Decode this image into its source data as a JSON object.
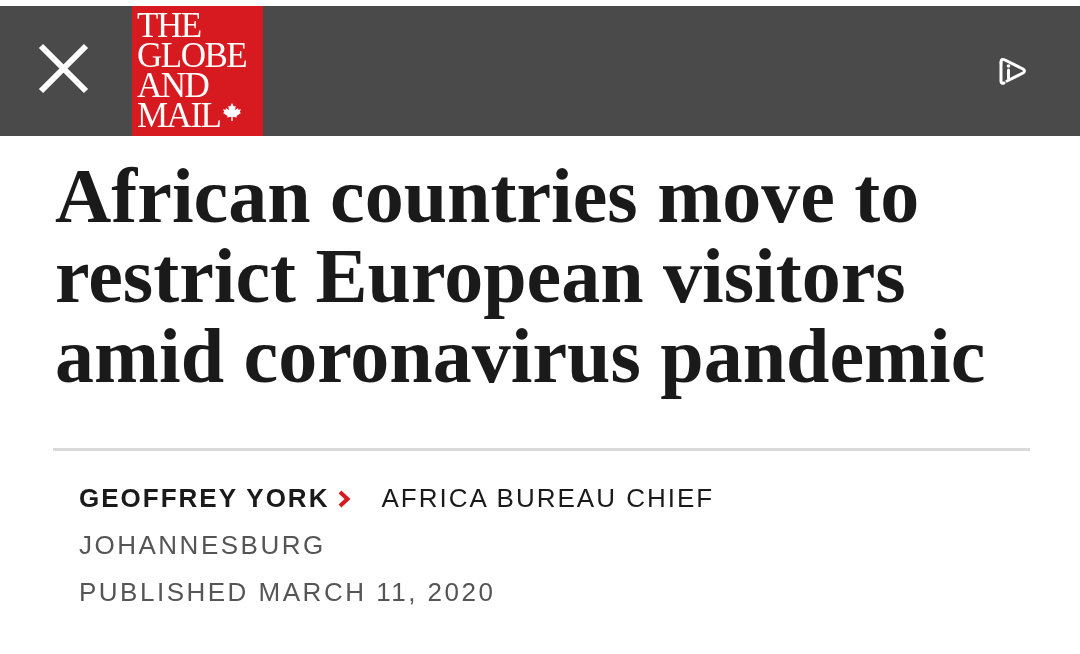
{
  "header": {
    "logo_lines": [
      "THE",
      "GLOBE",
      "AND",
      "MAIL"
    ]
  },
  "headline": "African countries move to restrict European visitors amid coronavirus pandemic",
  "byline": {
    "author": "GEOFFREY YORK",
    "role": "AFRICA BUREAU CHIEF",
    "location": "JOHANNESBURG",
    "published": "PUBLISHED MARCH 11, 2020"
  }
}
